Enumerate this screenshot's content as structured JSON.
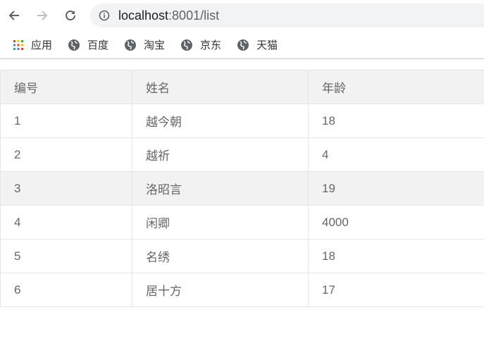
{
  "browser": {
    "url_host": "localhost",
    "url_path": ":8001/list"
  },
  "bookmarks": [
    {
      "label": "应用",
      "icon": "apps-grid-icon"
    },
    {
      "label": "百度",
      "icon": "globe-icon"
    },
    {
      "label": "淘宝",
      "icon": "globe-icon"
    },
    {
      "label": "京东",
      "icon": "globe-icon"
    },
    {
      "label": "天猫",
      "icon": "globe-icon"
    }
  ],
  "table": {
    "headers": [
      "编号",
      "姓名",
      "年龄"
    ],
    "rows": [
      [
        "1",
        "越今朝",
        "18"
      ],
      [
        "2",
        "越祈",
        "4"
      ],
      [
        "3",
        "洛昭言",
        "19"
      ],
      [
        "4",
        "闲卿",
        "4000"
      ],
      [
        "5",
        "名绣",
        "18"
      ],
      [
        "6",
        "居十方",
        "17"
      ]
    ],
    "highlighted_row": 2
  },
  "colors": {
    "header_bg": "#f2f2f2",
    "border": "#e6e6e6",
    "text": "#666666"
  }
}
